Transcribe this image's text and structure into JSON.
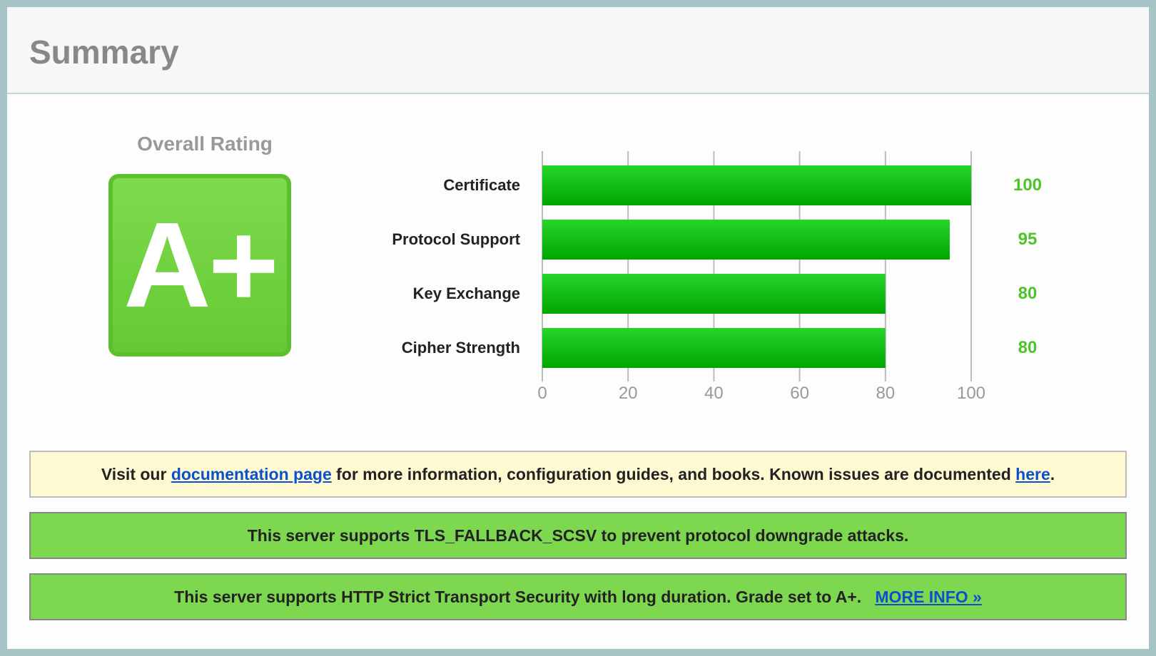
{
  "header": {
    "title": "Summary"
  },
  "overall": {
    "label": "Overall Rating",
    "grade": "A+"
  },
  "chart_data": {
    "type": "bar",
    "orientation": "horizontal",
    "categories": [
      "Certificate",
      "Protocol Support",
      "Key Exchange",
      "Cipher Strength"
    ],
    "values": [
      100,
      95,
      80,
      80
    ],
    "value_labels": [
      "100",
      "95",
      "80",
      "80"
    ],
    "xlim": [
      0,
      100
    ],
    "ticks": [
      "0",
      "20",
      "40",
      "60",
      "80",
      "100"
    ],
    "grid": true,
    "bar_color": "#1fc51f",
    "value_color": "#4cc52a"
  },
  "notices": {
    "doc": {
      "pre": "Visit our ",
      "link1": "documentation page",
      "mid": " for more information, configuration guides, and books. Known issues are documented ",
      "link2": "here",
      "post": "."
    },
    "fallback": {
      "text": "This server supports TLS_FALLBACK_SCSV to prevent protocol downgrade attacks."
    },
    "hsts": {
      "text": "This server supports HTTP Strict Transport Security with long duration. Grade set to A+.",
      "link": "MORE INFO »"
    }
  }
}
